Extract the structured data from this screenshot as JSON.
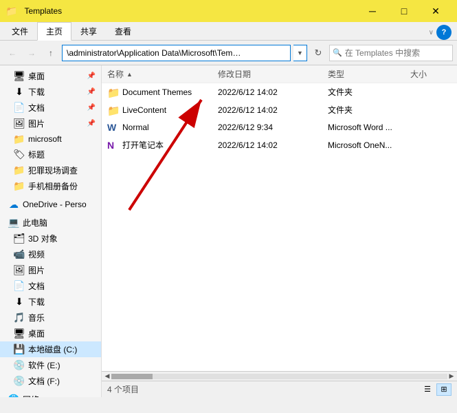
{
  "titlebar": {
    "title": "Templates",
    "min_label": "─",
    "max_label": "□",
    "close_label": "✕"
  },
  "ribbon": {
    "tabs": [
      "文件",
      "主页",
      "共享",
      "查看"
    ],
    "active_tab": "主页"
  },
  "addressbar": {
    "path": "\\administrator\\Application Data\\Microsoft\\Templates",
    "search_placeholder": "在 Templates 中搜索"
  },
  "nav": {
    "back": "←",
    "forward": "→",
    "up": "↑"
  },
  "sidebar": {
    "items": [
      {
        "id": "desktop",
        "label": "桌面",
        "icon": "desktop",
        "indent": 1,
        "pinned": true
      },
      {
        "id": "download",
        "label": "下载",
        "icon": "download",
        "indent": 1,
        "pinned": true
      },
      {
        "id": "docs",
        "label": "文档",
        "icon": "doc",
        "indent": 1,
        "pinned": true
      },
      {
        "id": "pics",
        "label": "图片",
        "icon": "pic",
        "indent": 1,
        "pinned": true
      },
      {
        "id": "microsoft",
        "label": "microsoft",
        "icon": "folder",
        "indent": 1
      },
      {
        "id": "label",
        "label": "标题",
        "icon": "tag",
        "indent": 1
      },
      {
        "id": "crime",
        "label": "犯罪现场调查",
        "icon": "folder",
        "indent": 1
      },
      {
        "id": "phone",
        "label": "手机相册备份",
        "icon": "folder",
        "indent": 1
      },
      {
        "id": "onedrive",
        "label": "OneDrive - Perso",
        "icon": "onedrive",
        "indent": 0
      },
      {
        "id": "thispc",
        "label": "此电脑",
        "icon": "pc",
        "indent": 0
      },
      {
        "id": "3d",
        "label": "3D 对象",
        "icon": "3d",
        "indent": 1
      },
      {
        "id": "video",
        "label": "视频",
        "icon": "video",
        "indent": 1
      },
      {
        "id": "pic2",
        "label": "图片",
        "icon": "pic",
        "indent": 1
      },
      {
        "id": "doc2",
        "label": "文档",
        "icon": "doc",
        "indent": 1
      },
      {
        "id": "dl2",
        "label": "下载",
        "icon": "download",
        "indent": 1
      },
      {
        "id": "music",
        "label": "音乐",
        "icon": "music",
        "indent": 1
      },
      {
        "id": "desk2",
        "label": "桌面",
        "icon": "desktop",
        "indent": 1
      },
      {
        "id": "driveC",
        "label": "本地磁盘 (C:)",
        "icon": "driveC",
        "indent": 1,
        "selected": true
      },
      {
        "id": "driveE",
        "label": "软件 (E:)",
        "icon": "driveE",
        "indent": 1
      },
      {
        "id": "driveF",
        "label": "文档 (F:)",
        "icon": "driveF",
        "indent": 1
      },
      {
        "id": "network",
        "label": "网络",
        "icon": "network",
        "indent": 0
      }
    ]
  },
  "content": {
    "columns": [
      "名称",
      "修改日期",
      "类型",
      "大小"
    ],
    "files": [
      {
        "name": "Document Themes",
        "date": "2022/6/12 14:02",
        "type": "文件夹",
        "size": "",
        "icon": "folder"
      },
      {
        "name": "LiveContent",
        "date": "2022/6/12 14:02",
        "type": "文件夹",
        "size": "",
        "icon": "folder"
      },
      {
        "name": "Normal",
        "date": "2022/6/12 9:34",
        "type": "Microsoft Word ...",
        "size": "",
        "icon": "word"
      },
      {
        "name": "打开笔记本",
        "date": "2022/6/12 14:02",
        "type": "Microsoft OneN...",
        "size": "",
        "icon": "onenote"
      }
    ]
  },
  "statusbar": {
    "count": "4 个项目"
  },
  "help_btn": "?"
}
